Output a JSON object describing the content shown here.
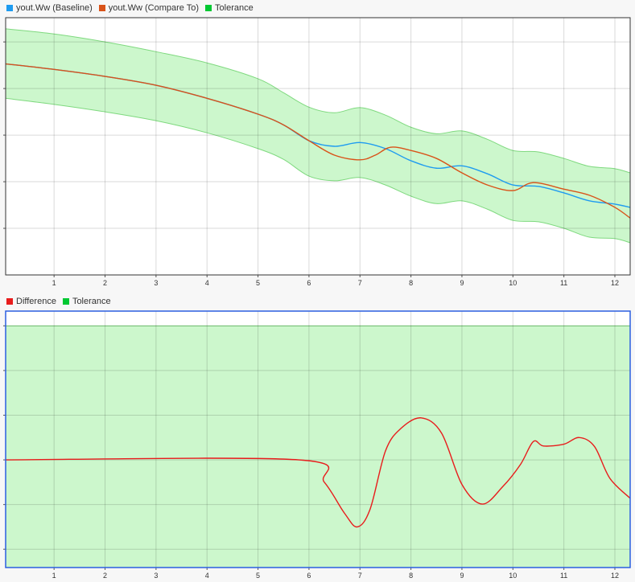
{
  "colors": {
    "baseline": "#1e9bf0",
    "compare": "#d95319",
    "tolerance_fill": "#ccf7cc",
    "tolerance_line": "#7fd97f",
    "difference": "#e81c1c",
    "tolerance_legend": "#00c832",
    "selected_border": "#2b5fe0"
  },
  "top_legend": [
    {
      "label": "yout.Ww (Baseline)",
      "color": "#1e9bf0"
    },
    {
      "label": "yout.Ww (Compare To)",
      "color": "#d95319"
    },
    {
      "label": "Tolerance",
      "color": "#00c832"
    }
  ],
  "bottom_legend": [
    {
      "label": "Difference",
      "color": "#e81c1c"
    },
    {
      "label": "Tolerance",
      "color": "#00c832"
    }
  ],
  "chart_data": [
    {
      "type": "line",
      "title": "Signal comparison",
      "xlim": [
        0.05,
        12.3
      ],
      "ylim": [
        0,
        5.52
      ],
      "xticks": [
        "1",
        "2",
        "3",
        "4",
        "5",
        "6",
        "7",
        "8",
        "9",
        "10",
        "11",
        "12"
      ],
      "grid": true,
      "series": [
        {
          "name": "yout.Ww (Baseline)",
          "x": [
            0.05,
            1,
            2,
            3,
            4,
            5,
            5.5,
            6,
            6.5,
            7,
            7.5,
            8,
            8.5,
            9,
            9.5,
            10,
            10.5,
            11,
            11.5,
            12,
            12.3
          ],
          "y": [
            4.53,
            4.41,
            4.26,
            4.07,
            3.79,
            3.45,
            3.22,
            2.88,
            2.76,
            2.84,
            2.71,
            2.45,
            2.29,
            2.34,
            2.17,
            1.93,
            1.9,
            1.76,
            1.59,
            1.52,
            1.45
          ]
        },
        {
          "name": "yout.Ww (Compare To)",
          "x": [
            0.05,
            1,
            2,
            3,
            4,
            5,
            5.5,
            6,
            6.5,
            7,
            7.3,
            7.6,
            8,
            8.5,
            9,
            9.5,
            10,
            10.4,
            11,
            11.5,
            12,
            12.3
          ],
          "y": [
            4.53,
            4.41,
            4.26,
            4.07,
            3.79,
            3.45,
            3.22,
            2.88,
            2.57,
            2.47,
            2.57,
            2.74,
            2.67,
            2.5,
            2.19,
            1.93,
            1.81,
            1.98,
            1.84,
            1.71,
            1.45,
            1.22
          ]
        },
        {
          "name": "Tolerance upper",
          "x": [
            0.05,
            1,
            2,
            3,
            4,
            5,
            5.5,
            6,
            6.5,
            7,
            7.5,
            8,
            8.5,
            9,
            9.5,
            10,
            10.5,
            11,
            11.5,
            12,
            12.3
          ],
          "y": [
            5.28,
            5.17,
            5.0,
            4.79,
            4.55,
            4.21,
            3.91,
            3.6,
            3.48,
            3.59,
            3.43,
            3.17,
            3.03,
            3.09,
            2.91,
            2.67,
            2.64,
            2.5,
            2.33,
            2.28,
            2.19
          ]
        },
        {
          "name": "Tolerance lower",
          "x": [
            0.05,
            1,
            2,
            3,
            4,
            5,
            5.5,
            6,
            6.5,
            7,
            7.5,
            8,
            8.5,
            9,
            9.5,
            10,
            10.5,
            11,
            11.5,
            12,
            12.3
          ],
          "y": [
            3.79,
            3.66,
            3.5,
            3.31,
            3.05,
            2.71,
            2.48,
            2.12,
            2.02,
            2.09,
            1.93,
            1.69,
            1.53,
            1.59,
            1.41,
            1.17,
            1.14,
            1.0,
            0.81,
            0.78,
            0.69
          ]
        }
      ]
    },
    {
      "type": "line",
      "title": "Difference",
      "xlim": [
        0.05,
        12.3
      ],
      "ylim": [
        -2.41,
        3.33
      ],
      "xticks": [
        "1",
        "2",
        "3",
        "4",
        "5",
        "6",
        "7",
        "8",
        "9",
        "10",
        "11",
        "12"
      ],
      "grid": true,
      "tolerance": [
        -3,
        3
      ],
      "series": [
        {
          "name": "Difference",
          "x": [
            0.05,
            5.8,
            6.3,
            6.7,
            6.95,
            7.2,
            7.5,
            7.8,
            8.2,
            8.6,
            9.0,
            9.4,
            9.8,
            10.15,
            10.4,
            10.6,
            11.0,
            11.3,
            11.6,
            11.9,
            12.3
          ],
          "y": [
            0,
            0,
            -0.5,
            -1.2,
            -1.5,
            -1.1,
            0.2,
            0.7,
            0.94,
            0.6,
            -0.55,
            -0.99,
            -0.6,
            -0.1,
            0.41,
            0.31,
            0.35,
            0.5,
            0.3,
            -0.41,
            -0.86
          ]
        }
      ]
    }
  ]
}
